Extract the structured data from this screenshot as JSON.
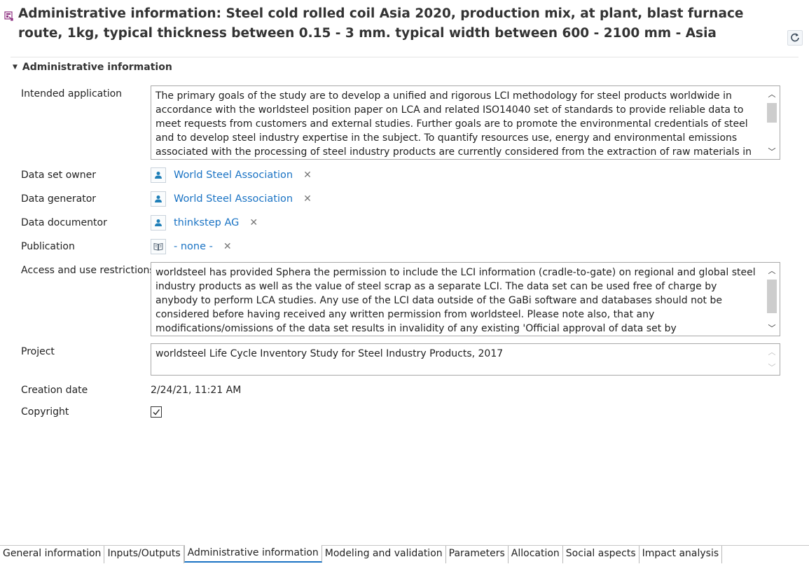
{
  "header": {
    "title": "Administrative information: Steel cold rolled coil Asia 2020, production mix, at plant, blast furnace route, 1kg, typical thickness between 0.15 - 3 mm. typical width between 600 - 2100 mm - Asia",
    "process_icon": "process-icon",
    "refresh_icon": "refresh-icon"
  },
  "section": {
    "title": "Administrative information",
    "toggle_icon": "chevron-down-icon"
  },
  "fields": {
    "intended_application": {
      "label": "Intended application",
      "value": "The primary goals of the study are to develop a unified and rigorous LCI methodology for steel products worldwide in accordance with the worldsteel position paper on LCA and related ISO14040 set of standards to provide reliable data to meet requests from customers and external studies. Further goals are to promote the environmental credentials of steel and to develop steel industry expertise in the subject. To quantify resources use, energy and environmental emissions associated with the processing of steel industry products are currently considered from the extraction of raw materials in the ground through to the finished product at"
    },
    "data_set_owner": {
      "label": "Data set owner",
      "value": "World Steel Association",
      "icon": "person-icon"
    },
    "data_generator": {
      "label": "Data generator",
      "value": "World Steel Association",
      "icon": "person-icon"
    },
    "data_documentor": {
      "label": "Data documentor",
      "value": "thinkstep AG",
      "icon": "person-icon"
    },
    "publication": {
      "label": "Publication",
      "value": "- none -",
      "icon": "book-icon"
    },
    "access_restrictions": {
      "label": "Access and use restrictions",
      "value": "worldsteel has provided Sphera the permission to include the LCI information (cradle-to-gate) on regional and global steel industry products as well as the value of steel scrap as a separate LCI. The data set can be used free of charge by anybody to perform LCA studies. Any use of the LCI data outside of the GaBi software and databases should not be considered before having received any written permission from worldsteel. Please note also, that any modifications/omissions of the data set results in invalidity of any existing 'Official approval of data set by producer/operator'. The impression must be avoided that this would still"
    },
    "project": {
      "label": "Project",
      "value": "worldsteel Life Cycle Inventory Study for Steel Industry Products, 2017"
    },
    "creation_date": {
      "label": "Creation date",
      "value": "2/24/21, 11:21 AM"
    },
    "copyright": {
      "label": "Copyright",
      "checked": true
    }
  },
  "remove_symbol": "✕",
  "tabs": [
    {
      "label": "General information"
    },
    {
      "label": "Inputs/Outputs"
    },
    {
      "label": "Administrative information",
      "active": true
    },
    {
      "label": "Modeling and validation"
    },
    {
      "label": "Parameters"
    },
    {
      "label": "Allocation"
    },
    {
      "label": "Social aspects"
    },
    {
      "label": "Impact analysis"
    }
  ],
  "colors": {
    "link": "#1a73c4",
    "accent_icon": "#1f7fb8",
    "process_icon": "#8b2d7e"
  }
}
